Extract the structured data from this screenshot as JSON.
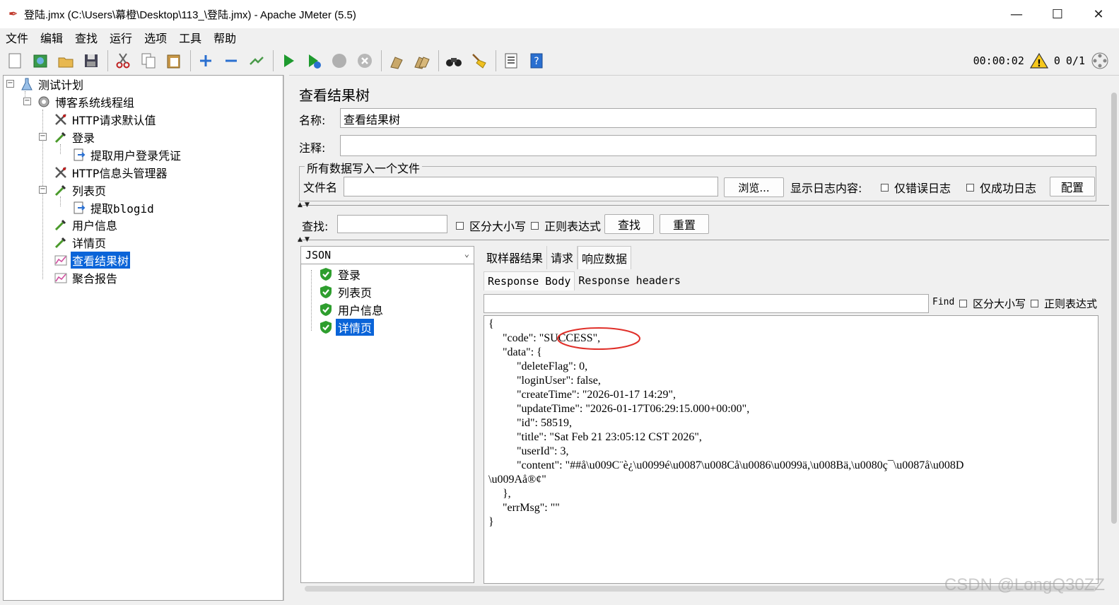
{
  "window": {
    "title": "登陆.jmx (C:\\Users\\幕橙\\Desktop\\113_\\登陆.jmx) - Apache JMeter (5.5)"
  },
  "menu": [
    "文件",
    "编辑",
    "查找",
    "运行",
    "选项",
    "工具",
    "帮助"
  ],
  "toolbar": {
    "timer": "00:00:02",
    "warn_count": "0",
    "threads": "0/1"
  },
  "tree": [
    {
      "label": "测试计划",
      "icon": "test-plan-icon"
    },
    {
      "label": "博客系统线程组",
      "icon": "gear-icon"
    },
    {
      "label": "HTTP请求默认值",
      "icon": "wrench-icon"
    },
    {
      "label": "登录",
      "icon": "pipette-icon"
    },
    {
      "label": "提取用户登录凭证",
      "icon": "extractor-icon"
    },
    {
      "label": "HTTP信息头管理器",
      "icon": "wrench-icon"
    },
    {
      "label": "列表页",
      "icon": "pipette-icon"
    },
    {
      "label": "提取blogid",
      "icon": "extractor-icon"
    },
    {
      "label": "用户信息",
      "icon": "pipette-icon"
    },
    {
      "label": "详情页",
      "icon": "pipette-icon"
    },
    {
      "label": "查看结果树",
      "icon": "chart-icon"
    },
    {
      "label": "聚合报告",
      "icon": "chart-icon"
    }
  ],
  "panel": {
    "title": "查看结果树",
    "name_label": "名称:",
    "name_value": "查看结果树",
    "comment_label": "注释:",
    "comment_value": "",
    "file_group_title": "所有数据写入一个文件",
    "file_label": "文件名",
    "file_value": "",
    "browse_button": "浏览...",
    "log_label": "显示日志内容:",
    "errors_only": "仅错误日志",
    "success_only": "仅成功日志",
    "config_button": "配置",
    "search_label": "查找:",
    "search_value": "",
    "case_sensitive": "区分大小写",
    "regex": "正则表达式",
    "find_button": "查找",
    "reset_button": "重置"
  },
  "results": {
    "renderer": "JSON",
    "samples": [
      {
        "label": "登录",
        "status": "success"
      },
      {
        "label": "列表页",
        "status": "success"
      },
      {
        "label": "用户信息",
        "status": "success"
      },
      {
        "label": "详情页",
        "status": "success"
      }
    ]
  },
  "detail_tabs": [
    "取样器结果",
    "请求",
    "响应数据"
  ],
  "response_tabs": [
    "Response Body",
    "Response headers"
  ],
  "response_find": {
    "find_label": "Find",
    "case_sensitive": "区分大小写",
    "regex": "正则表达式"
  },
  "response_body": [
    "{",
    "     \"code\": \"SUCCESS\",",
    "     \"data\": {",
    "          \"deleteFlag\": 0,",
    "          \"loginUser\": false,",
    "          \"createTime\": \"2026-01-17 14:29\",",
    "          \"updateTime\": \"2026-01-17T06:29:15.000+00:00\",",
    "          \"id\": 58519,",
    "          \"title\": \"Sat Feb 21 23:05:12 CST 2026\",",
    "          \"userId\": 3,",
    "          \"content\": \"##å\\u009C¨è¿\\u0099é\\u0087\\u008Cå\\u0086\\u0099ä,\\u008Bä,\\u0080ç¯\\u0087å\\u008D",
    "\\u009Aå®¢\"",
    "     },",
    "     \"errMsg\": \"\"",
    "}"
  ],
  "watermark": "CSDN @LongQ30ZZ",
  "colors": {
    "selection": "#0a64d8",
    "annotation_circle": "#e0302a",
    "success_shield": "#2e9e2e"
  }
}
